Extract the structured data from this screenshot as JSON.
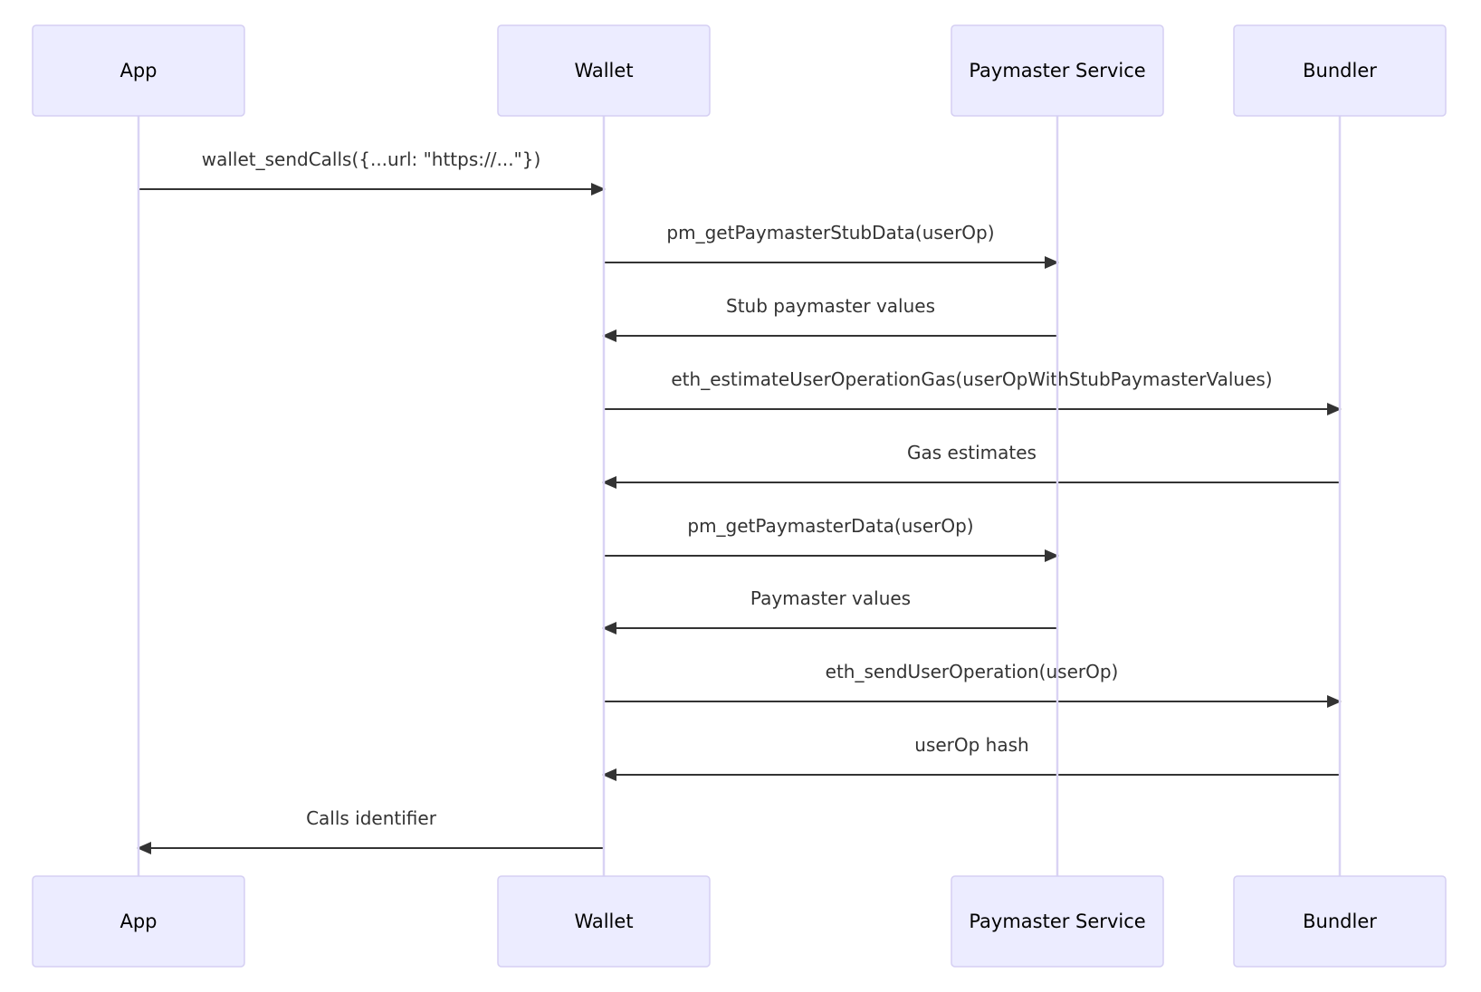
{
  "diagram": {
    "type": "sequence",
    "colors": {
      "actor_fill": "#ECECFF",
      "actor_border": "#D5CFF3",
      "lifeline": "#D9D3F4",
      "message": "#333333"
    },
    "participants": [
      {
        "id": "app",
        "label": "App"
      },
      {
        "id": "wallet",
        "label": "Wallet"
      },
      {
        "id": "paymaster",
        "label": "Paymaster Service"
      },
      {
        "id": "bundler",
        "label": "Bundler"
      }
    ],
    "messages": [
      {
        "from": "app",
        "to": "wallet",
        "label": "wallet_sendCalls({...url: \"https://...\"})"
      },
      {
        "from": "wallet",
        "to": "paymaster",
        "label": "pm_getPaymasterStubData(userOp)"
      },
      {
        "from": "paymaster",
        "to": "wallet",
        "label": "Stub paymaster values"
      },
      {
        "from": "wallet",
        "to": "bundler",
        "label": "eth_estimateUserOperationGas(userOpWithStubPaymasterValues)"
      },
      {
        "from": "bundler",
        "to": "wallet",
        "label": "Gas estimates"
      },
      {
        "from": "wallet",
        "to": "paymaster",
        "label": "pm_getPaymasterData(userOp)"
      },
      {
        "from": "paymaster",
        "to": "wallet",
        "label": "Paymaster values"
      },
      {
        "from": "wallet",
        "to": "bundler",
        "label": "eth_sendUserOperation(userOp)"
      },
      {
        "from": "bundler",
        "to": "wallet",
        "label": "userOp hash"
      },
      {
        "from": "wallet",
        "to": "app",
        "label": "Calls identifier"
      }
    ]
  }
}
